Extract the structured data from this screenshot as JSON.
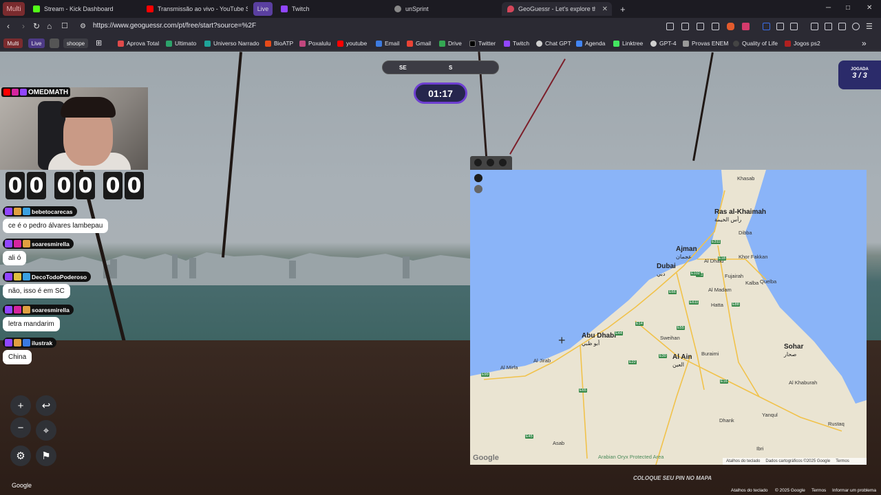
{
  "browser": {
    "multi_label": "Multi",
    "tabs": [
      {
        "label": "Stream - Kick Dashboard",
        "color": "#53fc18"
      },
      {
        "label": "Transmissão ao vivo - YouTube Studio",
        "color": "#ff0000"
      },
      {
        "label": "Live",
        "color": "#9146ff"
      },
      {
        "label": "Twitch",
        "color": "#9146ff"
      },
      {
        "label": "unSprint",
        "color": "#888888"
      },
      {
        "label": "GeoGuessr - Let's explore the world!",
        "color": "#d4465a"
      }
    ],
    "new_tab": "+",
    "url": "https://www.geoguessr.com/pt/free/start?source=%2F",
    "window": {
      "minimize": "─",
      "maximize": "□",
      "close": "✕"
    }
  },
  "bookmarks": {
    "pills": [
      "Multi",
      "Live",
      "",
      "shoope"
    ],
    "items": [
      {
        "label": "Aprova Total",
        "color": "#e04a4a"
      },
      {
        "label": "Ultimato",
        "color": "#2ca36b"
      },
      {
        "label": "Universo Narrado",
        "color": "#1fa39a"
      },
      {
        "label": "BioATP",
        "color": "#e64a19"
      },
      {
        "label": "Poxalulu",
        "color": "#c2477e"
      },
      {
        "label": "youtube",
        "color": "#ff0000"
      },
      {
        "label": "Email",
        "color": "#3d7be0"
      },
      {
        "label": "Gmail",
        "color": "#ea4335"
      },
      {
        "label": "Drive",
        "color": "#34a853"
      },
      {
        "label": "Twitter",
        "color": "#000000"
      },
      {
        "label": "Twitch",
        "color": "#9146ff"
      },
      {
        "label": "Chat GPT",
        "color": "#cfcfcf"
      },
      {
        "label": "Agenda",
        "color": "#4285f4"
      },
      {
        "label": "Linktree",
        "color": "#43e660"
      },
      {
        "label": "GPT-4",
        "color": "#cfcfcf"
      },
      {
        "label": "Provas ENEM",
        "color": "#999999"
      },
      {
        "label": "Quality of Life",
        "color": "#444444"
      },
      {
        "label": "Jogos ps2",
        "color": "#b02020"
      }
    ],
    "more": "»"
  },
  "game": {
    "compass": {
      "left": "SE",
      "center": "S"
    },
    "timer": "01:17",
    "round_label": "JOGADA",
    "round_value": "3 / 3",
    "pin_hint": "COLOQUE SEU PIN NO MAPA",
    "streetview_logo": "Google",
    "footer": {
      "shortcuts": "Atalhos do teclado",
      "copyright": "© 2025 Google",
      "terms": "Termos",
      "report": "Informar um problema"
    }
  },
  "overlay": {
    "handle": "OMEDMATH",
    "clock": [
      "0",
      "0",
      "0",
      "0",
      "0",
      "0"
    ],
    "chat": [
      {
        "user": "bebetocarecas",
        "text": "ce é o pedro álvares lambepau"
      },
      {
        "user": "soaresmirella",
        "text": "ali ó"
      },
      {
        "user": "DecoTodoPoderoso",
        "text": "não, isso é em SC"
      },
      {
        "user": "soaresmirella",
        "text": "letra mandarim"
      },
      {
        "user": "ilustrak",
        "text": "China"
      }
    ]
  },
  "map": {
    "cities": [
      {
        "name": "Ras al-Khaimah",
        "local": "رأس الخيمة"
      },
      {
        "name": "Ajman",
        "local": "عجمان"
      },
      {
        "name": "Dubai",
        "local": "دبي"
      },
      {
        "name": "Abu Dhabi",
        "local": "أبو ظبي"
      },
      {
        "name": "Al Ain",
        "local": "العين"
      },
      {
        "name": "Sohar",
        "local": "صحار"
      }
    ],
    "towns": [
      "Khasab",
      "Dibba",
      "Al Dhaid",
      "Khor Fakkan",
      "Fujairah",
      "Al Madam",
      "Hatta",
      "Kalba",
      "Sweihan",
      "Buraimi",
      "Al Jirab",
      "Al Khaburah",
      "Yanqul",
      "Dhank",
      "Rustaq",
      "Ibri",
      "Asab",
      "Arabian Oryx Protected Area",
      "Quelba",
      "Al Mirfa"
    ],
    "roads": [
      "E11",
      "E311",
      "E611",
      "E66",
      "E55",
      "E102",
      "E88",
      "E18",
      "E44",
      "E14",
      "E22",
      "E30",
      "E65",
      "E45",
      "E16",
      "E99"
    ],
    "google_logo": "Google",
    "footer": {
      "shortcuts": "Atalhos do teclado",
      "data": "Dados cartográficos ©2025 Google",
      "terms": "Termos"
    }
  }
}
